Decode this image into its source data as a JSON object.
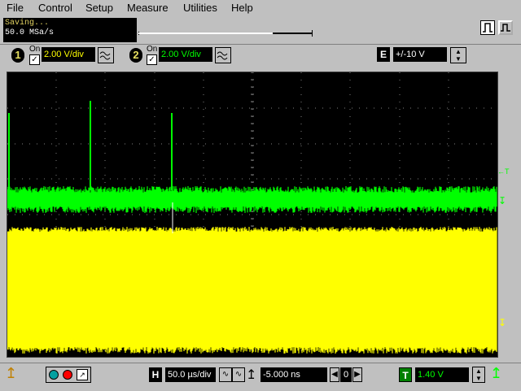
{
  "menu": {
    "items": [
      {
        "label": "File"
      },
      {
        "label": "Control"
      },
      {
        "label": "Setup"
      },
      {
        "label": "Measure"
      },
      {
        "label": "Utilities"
      },
      {
        "label": "Help"
      }
    ]
  },
  "status": {
    "line1": "Saving...",
    "line2": "50.0 MSa/s",
    "progress": 0.77
  },
  "channels": [
    {
      "number": "1",
      "on_label": "On",
      "checked": true,
      "vdiv": "2.00 V/div",
      "color": "#ffff00",
      "text_color": "#ffff00"
    },
    {
      "number": "2",
      "on_label": "On",
      "checked": true,
      "vdiv": "2.00 V/div",
      "color": "#00ff00",
      "text_color": "#00ff00"
    }
  ],
  "external": {
    "label": "E",
    "range": "+/-10 V"
  },
  "timebase": {
    "label": "H",
    "time_div": "50.0 µs/div",
    "delay": "-5.000 ns",
    "delay_ref": "0"
  },
  "trigger": {
    "label": "T",
    "level": "1.40 V",
    "marker": "T"
  },
  "colors": {
    "ch1": "#ffff00",
    "ch2": "#00ff00",
    "grid": "#808080",
    "screen": "#000000"
  }
}
